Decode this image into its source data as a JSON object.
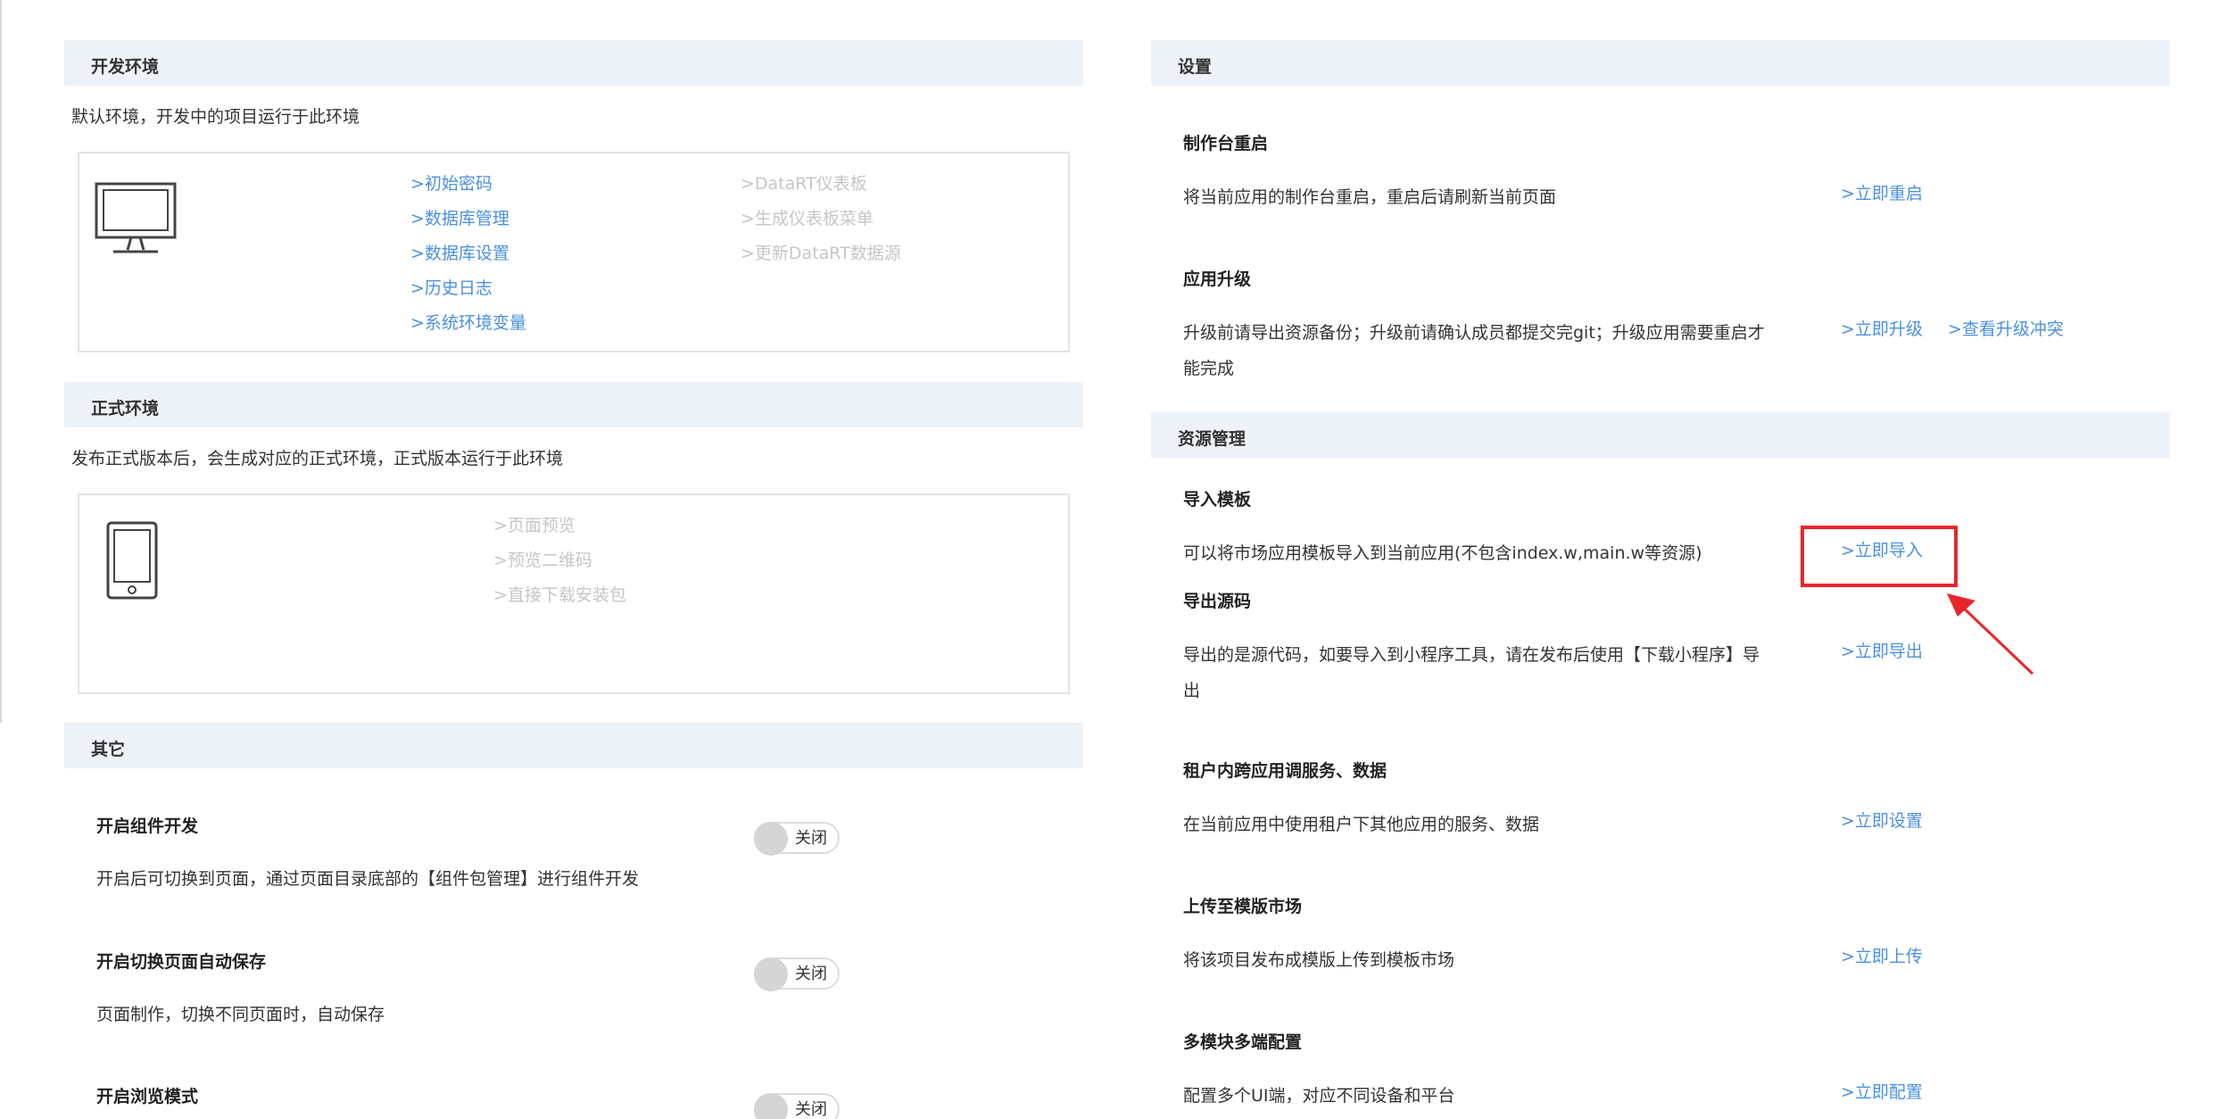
{
  "left": {
    "dev_env": {
      "header": "开发环境",
      "desc": "默认环境，开发中的项目运行于此环境",
      "icon": "monitor-icon",
      "links_active": [
        ">初始密码",
        ">数据库管理",
        ">数据库设置",
        ">历史日志",
        ">系统环境变量"
      ],
      "links_disabled": [
        ">DataRT仪表板",
        ">生成仪表板菜单",
        ">更新DataRT数据源"
      ]
    },
    "prod_env": {
      "header": "正式环境",
      "desc": "发布正式版本后，会生成对应的正式环境，正式版本运行于此环境",
      "icon": "tablet-icon",
      "links_disabled": [
        ">页面预览",
        ">预览二维码",
        ">直接下载安装包"
      ]
    },
    "other": {
      "header": "其它",
      "items": [
        {
          "title": "开启组件开发",
          "desc": "开启后可切换到页面，通过页面目录底部的【组件包管理】进行组件开发",
          "toggle": "关闭"
        },
        {
          "title": "开启切换页面自动保存",
          "desc": "页面制作，切换不同页面时，自动保存",
          "toggle": "关闭"
        },
        {
          "title": "开启浏览模式",
          "desc": "",
          "toggle": "关闭"
        }
      ]
    }
  },
  "right": {
    "settings": {
      "header": "设置",
      "items": [
        {
          "title": "制作台重启",
          "desc": "将当前应用的制作台重启，重启后请刷新当前页面",
          "link": ">立即重启"
        },
        {
          "title": "应用升级",
          "desc_line1": "升级前请导出资源备份；升级前请确认成员都提交完git；升级应用需要重启才",
          "desc_line2": "能完成",
          "link": ">立即升级",
          "link2": ">查看升级冲突"
        }
      ]
    },
    "resources": {
      "header": "资源管理",
      "items": [
        {
          "title": "导入模板",
          "desc": "可以将市场应用模板导入到当前应用(不包含index.w,main.w等资源)",
          "link": ">立即导入"
        },
        {
          "title": "导出源码",
          "desc_line1": "导出的是源代码，如要导入到小程序工具，请在发布后使用【下载小程序】导",
          "desc_line2": "出",
          "link": ">立即导出"
        },
        {
          "title": "租户内跨应用调服务、数据",
          "desc": "在当前应用中使用租户下其他应用的服务、数据",
          "link": ">立即设置"
        },
        {
          "title": "上传至模版市场",
          "desc": "将该项目发布成模版上传到模板市场",
          "link": ">立即上传"
        },
        {
          "title": "多模块多端配置",
          "desc": "配置多个UI端，对应不同设备和平台",
          "link": ">立即配置"
        }
      ]
    }
  },
  "annotation": {
    "highlight_color": "#e8262a"
  },
  "colors": {
    "link": "#4a90e2",
    "disabled": "#c6c6c6",
    "header_bg": "#edf2f9"
  }
}
